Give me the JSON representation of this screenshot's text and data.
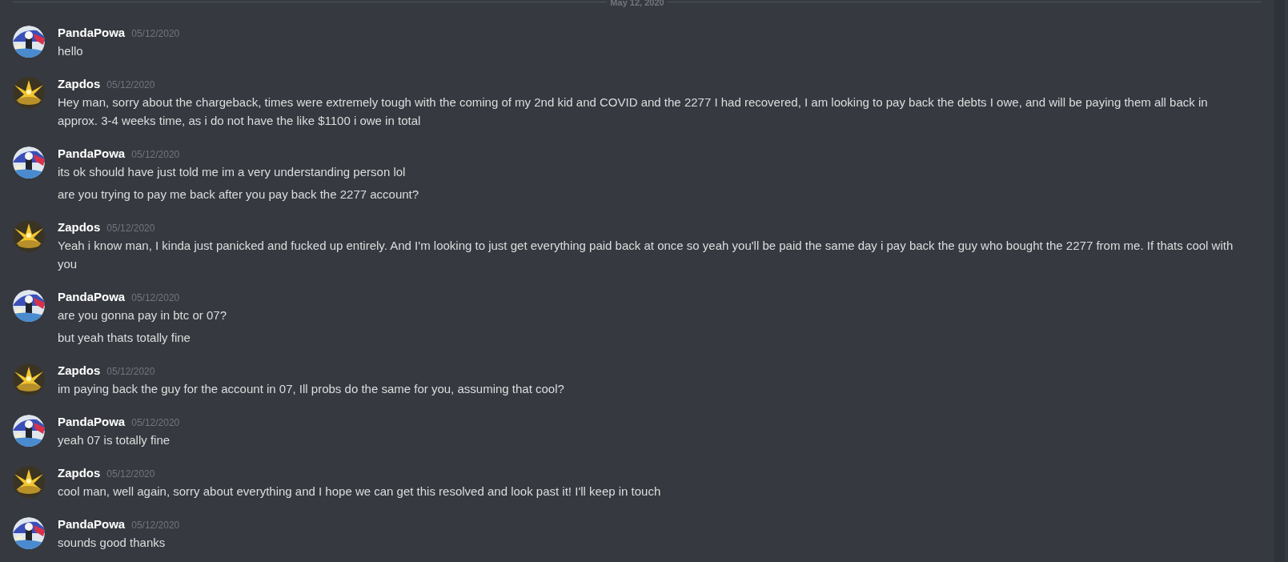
{
  "date_divider": "May 12, 2020",
  "messages": [
    {
      "author": "PandaPowa",
      "avatar": {
        "kind": "panda"
      },
      "timestamp": "05/12/2020",
      "lines": [
        "hello"
      ]
    },
    {
      "author": "Zapdos",
      "avatar": {
        "kind": "bird"
      },
      "timestamp": "05/12/2020",
      "lines": [
        "Hey man, sorry about the chargeback, times were extremely tough with the coming of my 2nd kid and COVID and the 2277 I had recovered, I am looking to pay back the debts I owe, and will be paying them all back in approx. 3-4 weeks time, as i do not have the like $1100 i owe in total"
      ]
    },
    {
      "author": "PandaPowa",
      "avatar": {
        "kind": "panda"
      },
      "timestamp": "05/12/2020",
      "lines": [
        "its ok should have just told me im a very understanding person lol",
        "are you trying to pay me back after you pay back the 2277 account?"
      ]
    },
    {
      "author": "Zapdos",
      "avatar": {
        "kind": "bird"
      },
      "timestamp": "05/12/2020",
      "lines": [
        "Yeah i know man, I kinda just panicked and fucked up entirely. And I'm looking to just get everything paid back at once so yeah you'll be paid the same day i pay back the guy who bought the 2277 from me. If thats cool with you"
      ]
    },
    {
      "author": "PandaPowa",
      "avatar": {
        "kind": "panda"
      },
      "timestamp": "05/12/2020",
      "lines": [
        "are you gonna pay in btc or 07?",
        "but yeah thats totally fine"
      ]
    },
    {
      "author": "Zapdos",
      "avatar": {
        "kind": "bird"
      },
      "timestamp": "05/12/2020",
      "lines": [
        "im paying back the guy for the account in 07, Ill probs do the same for you, assuming that cool?"
      ]
    },
    {
      "author": "PandaPowa",
      "avatar": {
        "kind": "panda"
      },
      "timestamp": "05/12/2020",
      "lines": [
        "yeah 07 is totally fine"
      ]
    },
    {
      "author": "Zapdos",
      "avatar": {
        "kind": "bird"
      },
      "timestamp": "05/12/2020",
      "lines": [
        "cool man, well again, sorry about everything and I hope we can get this resolved and look past it! I'll keep in touch"
      ]
    },
    {
      "author": "PandaPowa",
      "avatar": {
        "kind": "panda"
      },
      "timestamp": "05/12/2020",
      "lines": [
        "sounds good thanks"
      ]
    }
  ]
}
